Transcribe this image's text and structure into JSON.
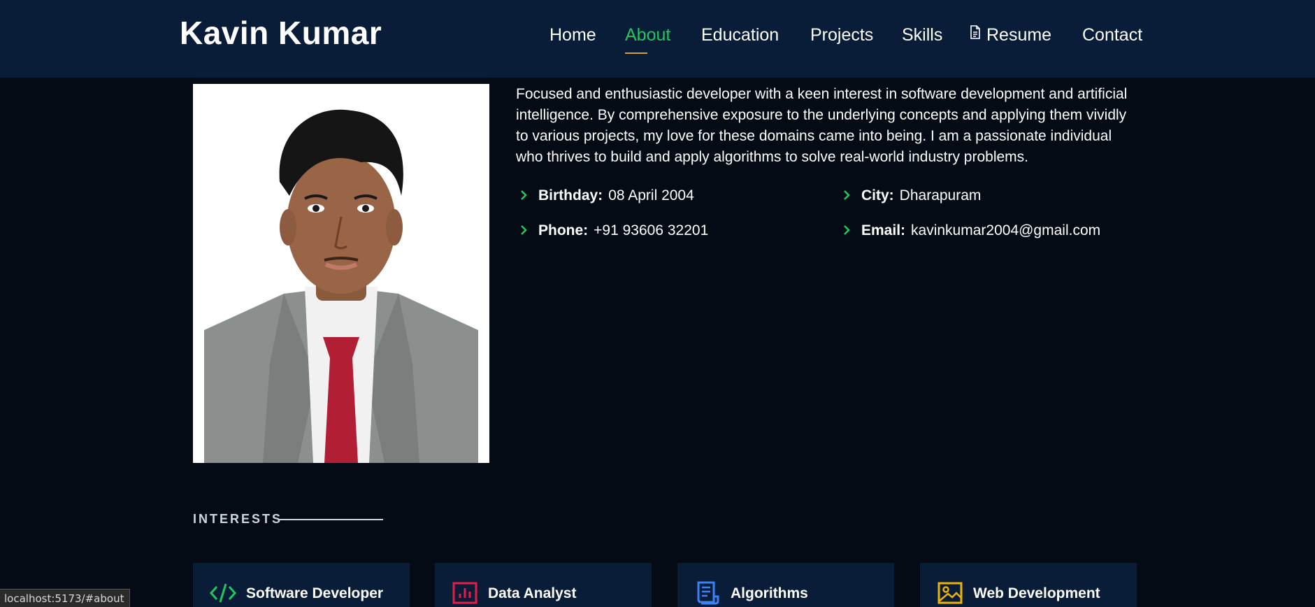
{
  "header": {
    "brand": "Kavin Kumar",
    "nav": [
      {
        "label": "Home",
        "active": false
      },
      {
        "label": "About",
        "active": true
      },
      {
        "label": "Education",
        "active": false
      },
      {
        "label": "Projects",
        "active": false
      },
      {
        "label": "Skills",
        "active": false
      },
      {
        "label": "Resume",
        "active": false,
        "icon": "document-icon"
      },
      {
        "label": "Contact",
        "active": false
      }
    ]
  },
  "about": {
    "bio": "Focused and enthusiastic developer with a keen interest in software development and artificial intelligence. By comprehensive exposure to the underlying concepts and applying them vividly to various projects, my love for these domains came into being. I am a passionate individual who thrives to build and apply algorithms to solve real-world industry problems.",
    "info": {
      "birthday": {
        "label": "Birthday:",
        "value": "08 April 2004"
      },
      "city": {
        "label": "City:",
        "value": "Dharapuram"
      },
      "phone": {
        "label": "Phone:",
        "value": "+91 93606 32201"
      },
      "email": {
        "label": "Email:",
        "value": "kavinkumar2004@gmail.com"
      }
    }
  },
  "interests": {
    "title": "INTERESTS",
    "cards": [
      {
        "label": "Software Developer",
        "icon": "code-icon",
        "color": "#22c55e"
      },
      {
        "label": "Data Analyst",
        "icon": "bar-chart-icon",
        "color": "#e11d48"
      },
      {
        "label": "Algorithms",
        "icon": "receipt-icon",
        "color": "#3b82f6"
      },
      {
        "label": "Web Development",
        "icon": "image-icon",
        "color": "#eab308"
      }
    ]
  },
  "status": {
    "url": "localhost:5173/#about"
  },
  "colors": {
    "accent": "#22c55e",
    "underline": "#d4a41c",
    "header_bg": "#0a1d38",
    "page_bg": "#040b14"
  }
}
